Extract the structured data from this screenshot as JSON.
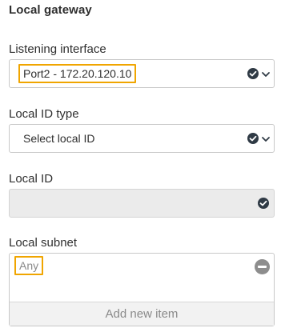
{
  "section": {
    "title": "Local gateway"
  },
  "listening_interface": {
    "label": "Listening interface",
    "value": "Port2 - 172.20.120.10",
    "icons": [
      "check-circle-icon",
      "chevron-down-icon"
    ]
  },
  "local_id_type": {
    "label": "Local ID type",
    "value": "Select local ID",
    "icons": [
      "check-circle-icon",
      "chevron-down-icon"
    ]
  },
  "local_id": {
    "label": "Local ID",
    "value": "",
    "icons": [
      "check-circle-icon"
    ]
  },
  "local_subnet": {
    "label": "Local subnet",
    "items": [
      "Any"
    ],
    "add_label": "Add new item",
    "icons": [
      "remove-circle-icon"
    ]
  },
  "colors": {
    "highlight": "#f0a500",
    "icon_dark": "#2f3a45",
    "disabled_bg": "#ebebeb"
  }
}
